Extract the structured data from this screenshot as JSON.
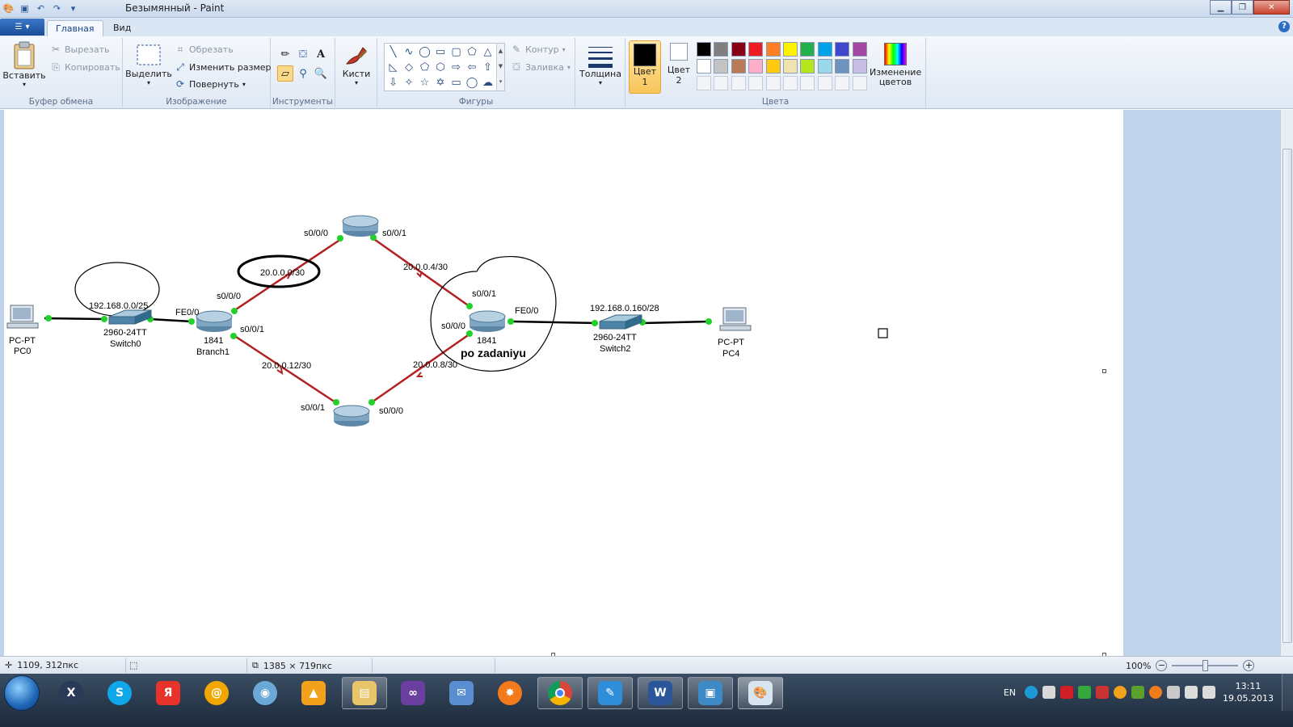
{
  "window": {
    "title": "Безымянный - Paint"
  },
  "tabs": {
    "home": "Главная",
    "view": "Вид"
  },
  "ribbon": {
    "clipboard": {
      "label": "Буфер обмена",
      "paste": "Вставить",
      "cut": "Вырезать",
      "copy": "Копировать"
    },
    "image": {
      "label": "Изображение",
      "select": "Выделить",
      "crop": "Обрезать",
      "resize": "Изменить размер",
      "rotate": "Повернуть"
    },
    "tools": {
      "label": "Инструменты"
    },
    "brushes": {
      "label": "Кисти"
    },
    "shapes": {
      "label": "Фигуры",
      "outline": "Контур",
      "fill": "Заливка"
    },
    "thickness": {
      "label": "Толщина"
    },
    "colors": {
      "label": "Цвета",
      "color1": "Цвет 1",
      "color2": "Цвет 2",
      "edit": "Изменение цветов",
      "row1": [
        "#000000",
        "#7f7f7f",
        "#880015",
        "#ed1c24",
        "#ff7f27",
        "#fff200",
        "#22b14c",
        "#00a2e8",
        "#3f48cc",
        "#a349a4"
      ],
      "row2": [
        "#ffffff",
        "#c3c3c3",
        "#b97a57",
        "#ffaec9",
        "#ffc90e",
        "#efe4b0",
        "#b5e61d",
        "#99d9ea",
        "#7092be",
        "#c8bfe7"
      ]
    }
  },
  "diagram": {
    "pc0": {
      "type": "PC-PT",
      "name": "PC0"
    },
    "switch0": {
      "model": "2960-24TT",
      "name": "Switch0"
    },
    "net_lan1": "192.168.0.0/25",
    "branch1": {
      "model": "1841",
      "name": "Branch1",
      "fe": "FE0/0",
      "s000": "s0/0/0",
      "s001": "s0/0/1"
    },
    "net_top_left": "20.0.0.0/30",
    "top_router": {
      "s000": "s0/0/0",
      "s001": "s0/0/1"
    },
    "net_top_right": "20.0.0.4/30",
    "net_bottom_left": "20.0.0.12/30",
    "net_bottom_right": "20.0.0.8/30",
    "bottom_router": {
      "s001": "s0/0/1",
      "s000": "s0/0/0"
    },
    "main_router": {
      "model": "1841",
      "s001": "s0/0/1",
      "s000": "s0/0/0",
      "fe": "FE0/0",
      "note": "po zadaniyu"
    },
    "net_lan2": "192.168.0.160/28",
    "switch2": {
      "model": "2960-24TT",
      "name": "Switch2"
    },
    "pc4": {
      "type": "PC-PT",
      "name": "PC4"
    }
  },
  "status": {
    "cursor": "1109, 312пкс",
    "size": "1385 × 719пкс",
    "zoom": "100%"
  },
  "taskbar": {
    "lang": "EN",
    "time": "13:11",
    "date": "19.05.2013"
  }
}
